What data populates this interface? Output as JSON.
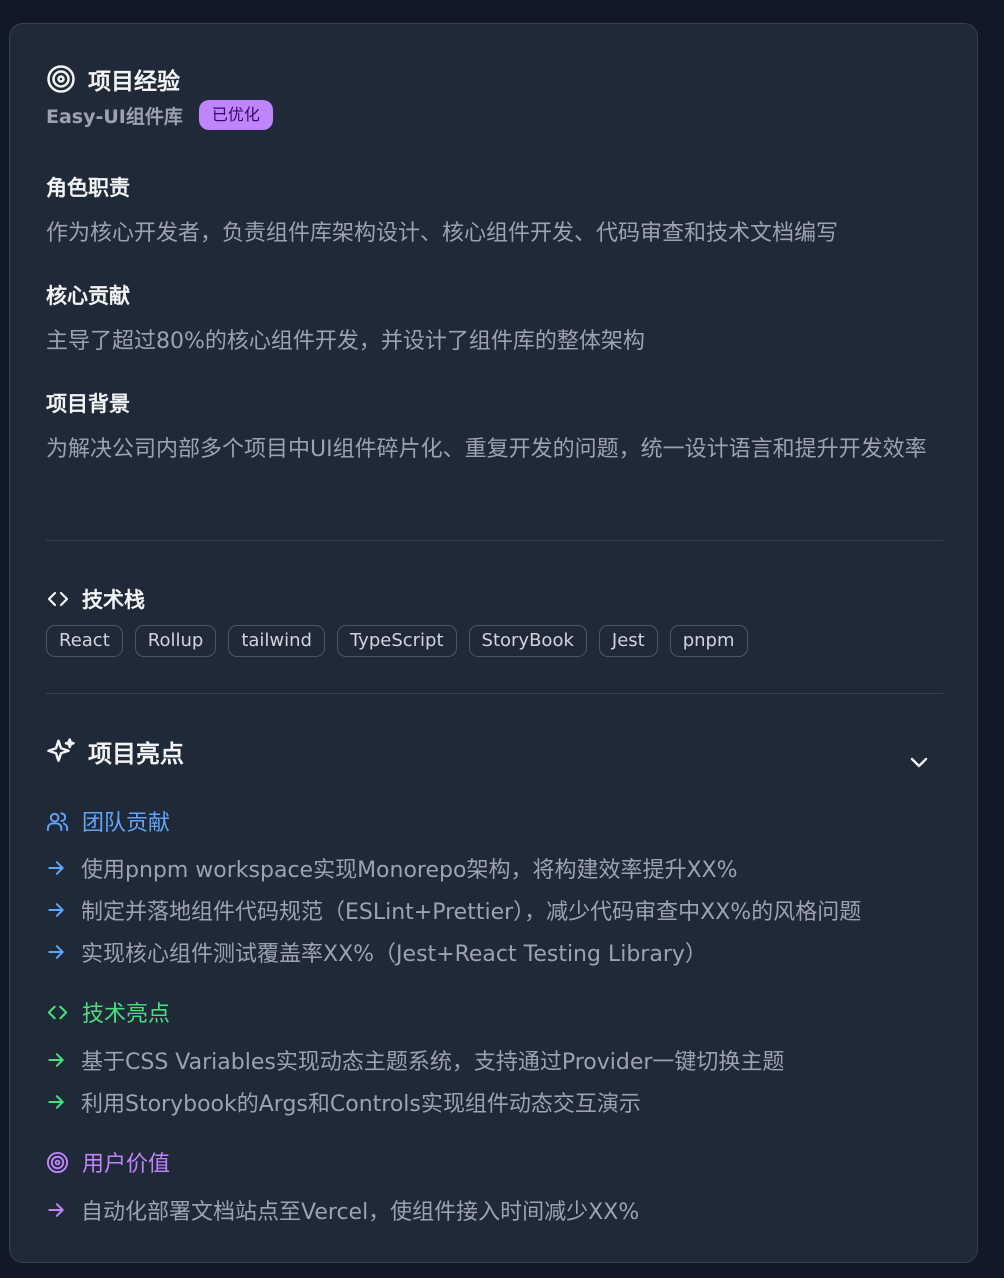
{
  "header": {
    "title": "项目经验",
    "project_name": "Easy-UI组件库",
    "badge": "已优化"
  },
  "sections": [
    {
      "heading": "角色职责",
      "text": "作为核心开发者，负责组件库架构设计、核心组件开发、代码审查和技术文档编写"
    },
    {
      "heading": "核心贡献",
      "text": "主导了超过80%的核心组件开发，并设计了组件库的整体架构"
    },
    {
      "heading": "项目背景",
      "text": "为解决公司内部多个项目中UI组件碎片化、重复开发的问题，统一设计语言和提升开发效率"
    }
  ],
  "tech_stack": {
    "title": "技术栈",
    "tags": [
      "React",
      "Rollup",
      "tailwind",
      "TypeScript",
      "StoryBook",
      "Jest",
      "pnpm"
    ]
  },
  "highlights": {
    "title": "项目亮点",
    "categories": [
      {
        "label": "团队贡献",
        "icon": "users-icon",
        "color": "#60a5fa",
        "items": [
          "使用pnpm workspace实现Monorepo架构，将构建效率提升XX%",
          "制定并落地组件代码规范（ESLint+Prettier），减少代码审查中XX%的风格问题",
          "实现核心组件测试覆盖率XX%（Jest+React Testing Library）"
        ]
      },
      {
        "label": "技术亮点",
        "icon": "code-icon",
        "color": "#4ade80",
        "items": [
          "基于CSS Variables实现动态主题系统，支持通过Provider一键切换主题",
          "利用Storybook的Args和Controls实现组件动态交互演示"
        ]
      },
      {
        "label": "用户价值",
        "icon": "target-icon",
        "color": "#c084fc",
        "items": [
          "自动化部署文档站点至Vercel，使组件接入时间减少XX%"
        ]
      }
    ]
  },
  "colors": {
    "background": "#111827",
    "card": "#1f2937",
    "badge": "#c084fc"
  }
}
